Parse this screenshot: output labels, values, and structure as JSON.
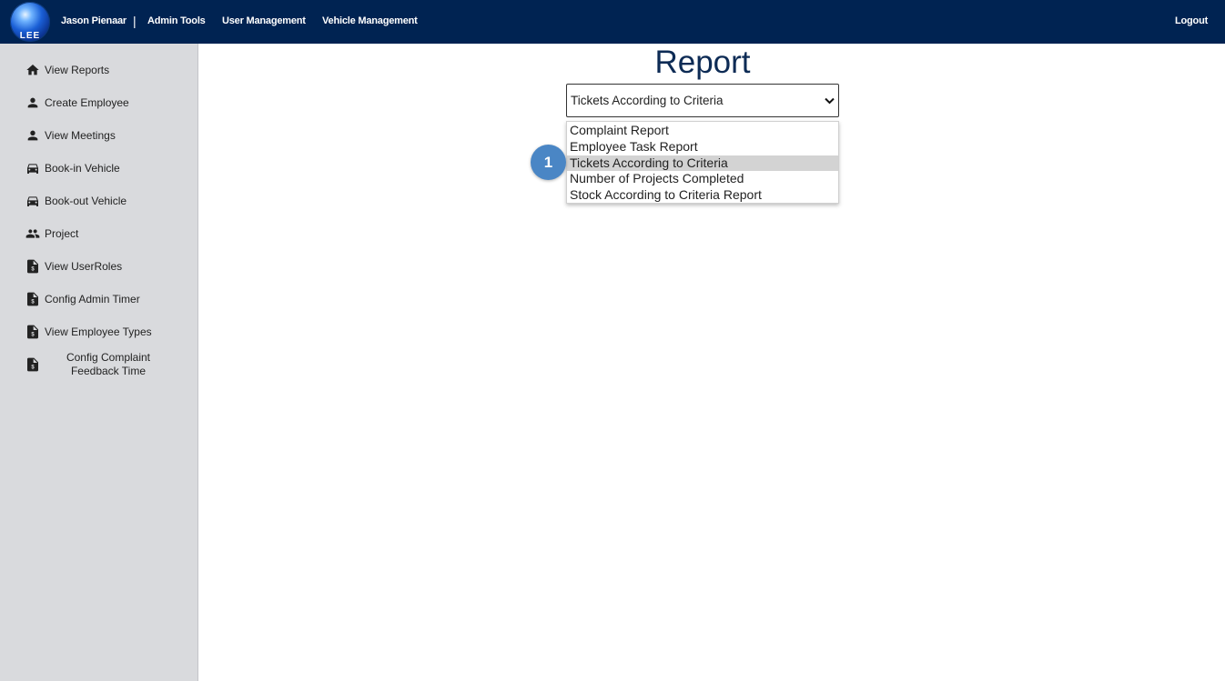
{
  "header": {
    "logo_text": "LEE",
    "user_name": "Jason Pienaar",
    "separator": "|",
    "nav": [
      "Admin Tools",
      "User Management",
      "Vehicle Management"
    ],
    "logout": "Logout"
  },
  "sidebar": {
    "items": [
      {
        "label": "View Reports",
        "icon": "home-icon"
      },
      {
        "label": "Create Employee",
        "icon": "person-icon"
      },
      {
        "label": "View Meetings",
        "icon": "person-icon"
      },
      {
        "label": "Book-in Vehicle",
        "icon": "car-icon"
      },
      {
        "label": "Book-out Vehicle",
        "icon": "car-icon"
      },
      {
        "label": "Project",
        "icon": "group-icon"
      },
      {
        "label": "View UserRoles",
        "icon": "document-icon"
      },
      {
        "label": "Config Admin Timer",
        "icon": "document-icon"
      },
      {
        "label": "View Employee Types",
        "icon": "document-icon"
      },
      {
        "label": "Config Complaint Feedback Time",
        "icon": "document-icon"
      }
    ]
  },
  "main": {
    "title": "Report",
    "select": {
      "value": "Tickets According to Criteria",
      "options": [
        "Complaint Report",
        "Employee Task Report",
        "Tickets According to Criteria",
        "Number of Projects Completed",
        "Stock According to Criteria Report"
      ],
      "selected_index": 2
    }
  },
  "annotation": {
    "step": "1",
    "color": "#4a86c5"
  },
  "colors": {
    "topbar": "#002352",
    "sidebar": "#d9dadd",
    "title": "#0d2b55",
    "selected_option": "#d3d3d3"
  }
}
